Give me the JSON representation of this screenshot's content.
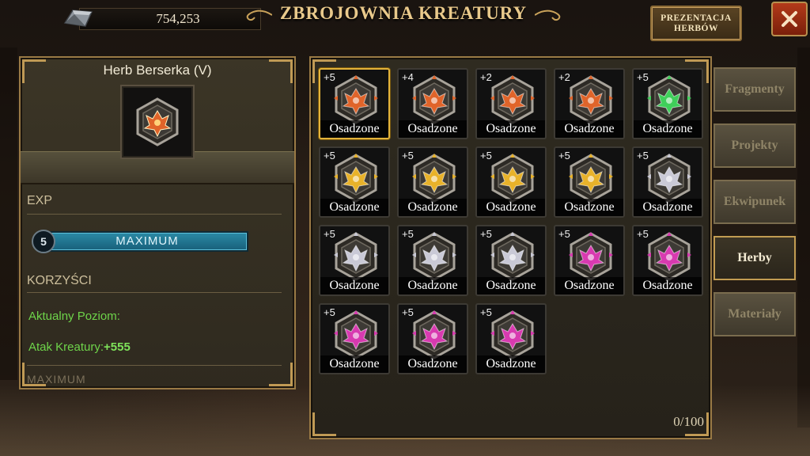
{
  "header": {
    "currency_value": "754,253",
    "title": "ZBROJOWNIA KREATURY",
    "presentation_button_line1": "PREZENTACJA",
    "presentation_button_line2": "HERBÓW",
    "close_icon": "close-x-icon"
  },
  "details": {
    "item_name": "Herb Berserka (V)",
    "exp_label": "EXP",
    "level": "5",
    "exp_bar_text": "MAXIMUM",
    "exp_fill": 1.0,
    "benefits_label": "KORZYŚCI",
    "current_level_label": "Aktualny Poziom:",
    "attack_label": "Atak Kreatury:",
    "attack_value": "+555",
    "next_section_cut": "MAXIMUM"
  },
  "inventory": {
    "items": [
      {
        "plus": "+5",
        "status": "Osadzone",
        "color": "#e0642a",
        "selected": true
      },
      {
        "plus": "+4",
        "status": "Osadzone",
        "color": "#e0642a"
      },
      {
        "plus": "+2",
        "status": "Osadzone",
        "color": "#e0642a"
      },
      {
        "plus": "+2",
        "status": "Osadzone",
        "color": "#e0642a"
      },
      {
        "plus": "+5",
        "status": "Osadzone",
        "color": "#3fcf5a"
      },
      {
        "plus": "+5",
        "status": "Osadzone",
        "color": "#e8b22a"
      },
      {
        "plus": "+5",
        "status": "Osadzone",
        "color": "#e8b22a"
      },
      {
        "plus": "+5",
        "status": "Osadzone",
        "color": "#e8b22a"
      },
      {
        "plus": "+5",
        "status": "Osadzone",
        "color": "#e8b22a"
      },
      {
        "plus": "+5",
        "status": "Osadzone",
        "color": "#c9c9d6"
      },
      {
        "plus": "+5",
        "status": "Osadzone",
        "color": "#c9c9d6"
      },
      {
        "plus": "+5",
        "status": "Osadzone",
        "color": "#c9c9d6"
      },
      {
        "plus": "+5",
        "status": "Osadzone",
        "color": "#c9c9d6"
      },
      {
        "plus": "+5",
        "status": "Osadzone",
        "color": "#d83ab0"
      },
      {
        "plus": "+5",
        "status": "Osadzone",
        "color": "#d83ab0"
      },
      {
        "plus": "+5",
        "status": "Osadzone",
        "color": "#d83ab0"
      },
      {
        "plus": "+5",
        "status": "Osadzone",
        "color": "#d83ab0"
      },
      {
        "plus": "+5",
        "status": "Osadzone",
        "color": "#d83ab0"
      }
    ],
    "count_text": "0/100"
  },
  "tabs": [
    {
      "label": "Fragmenty",
      "active": false
    },
    {
      "label": "Projekty",
      "active": false
    },
    {
      "label": "Ekwipunek",
      "active": false
    },
    {
      "label": "Herby",
      "active": true
    },
    {
      "label": "Materiały",
      "active": false
    }
  ]
}
